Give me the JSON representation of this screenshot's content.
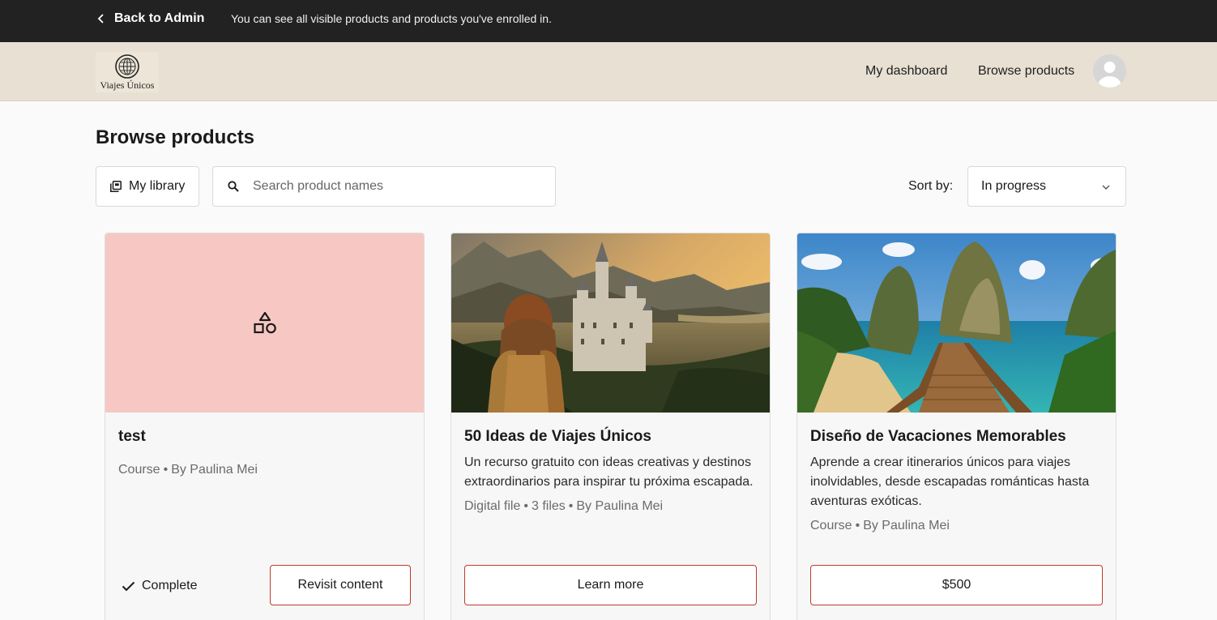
{
  "admin_bar": {
    "back_label": "Back to Admin",
    "note": "You can see all visible products and products you've enrolled in."
  },
  "header": {
    "logo_text": "Viajes Únicos",
    "nav": [
      {
        "label": "My dashboard"
      },
      {
        "label": "Browse products"
      }
    ],
    "avatar_icon": "user-avatar-icon"
  },
  "main": {
    "title": "Browse products",
    "library_label": "My library",
    "search_placeholder": "Search product names",
    "sort_label": "Sort by:",
    "sort_value": "In progress"
  },
  "products": [
    {
      "title": "test",
      "description": "",
      "type": "Course",
      "author": "By Paulina Mei",
      "thumb_color": "#f7c8c3",
      "status": "Complete",
      "action_label": "Revisit content"
    },
    {
      "title": "50 Ideas de Viajes Únicos",
      "description": "Un recurso gratuito con ideas creativas y destinos extraordinarios para inspirar tu próxima escapada.",
      "type": "Digital file",
      "files": "3 files",
      "author": "By Paulina Mei",
      "action_label": "Learn more"
    },
    {
      "title": "Diseño de Vacaciones Memorables",
      "description": "Aprende a crear itinerarios únicos para viajes inolvidables, desde escapadas románticas hasta aventuras exóticas.",
      "type": "Course",
      "author": "By Paulina Mei",
      "action_label": "$500"
    }
  ],
  "colors": {
    "admin_bar": "#222222",
    "header_bg": "#e7e0d3",
    "button_border": "#c0392b",
    "placeholder_thumb": "#f7c8c3"
  }
}
